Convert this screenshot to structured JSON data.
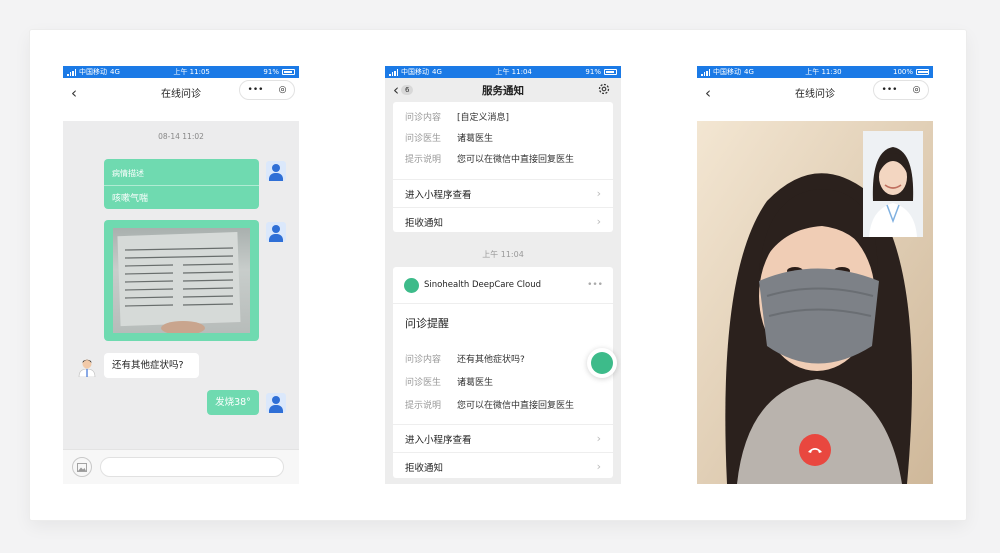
{
  "phones": [
    {
      "status": {
        "carrier": "中国移动",
        "network": "4G",
        "time": "上午 11:05",
        "battery": "91%"
      },
      "nav_title": "在线问诊",
      "chat": {
        "timestamp": "08-14 11:02",
        "card_title": "病情描述",
        "card_body": "咳嗽气喘",
        "doctor_question": "还有其他症状吗?",
        "reply": "发烧38°"
      }
    },
    {
      "status": {
        "carrier": "中国移动",
        "network": "4G",
        "time": "上午 11:04",
        "battery": "91%"
      },
      "nav_title": "服务通知",
      "unread_count": "6",
      "first_card": {
        "rows": [
          {
            "key": "问诊内容",
            "value": "[自定义消息]"
          },
          {
            "key": "问诊医生",
            "value": "诸葛医生"
          },
          {
            "key": "提示说明",
            "value": "您可以在微信中直接回复医生"
          }
        ],
        "links": [
          "进入小程序查看",
          "拒收通知"
        ]
      },
      "divider_time": "上午 11:04",
      "second_card": {
        "app_name": "Sinohealth DeepCare Cloud",
        "title": "问诊提醒",
        "rows": [
          {
            "key": "问诊内容",
            "value": "还有其他症状吗?"
          },
          {
            "key": "问诊医生",
            "value": "诸葛医生"
          },
          {
            "key": "提示说明",
            "value": "您可以在微信中直接回复医生"
          }
        ],
        "links": [
          "进入小程序查看",
          "拒收通知"
        ]
      }
    },
    {
      "status": {
        "carrier": "中国移动",
        "network": "4G",
        "time": "上午 11:30",
        "battery": "100%"
      },
      "nav_title": "在线问诊"
    }
  ],
  "colors": {
    "status_bar": "#1b7ae6",
    "bubble": "#6fdab0",
    "hangup": "#e9473f",
    "logo": "#3dbb8a"
  }
}
